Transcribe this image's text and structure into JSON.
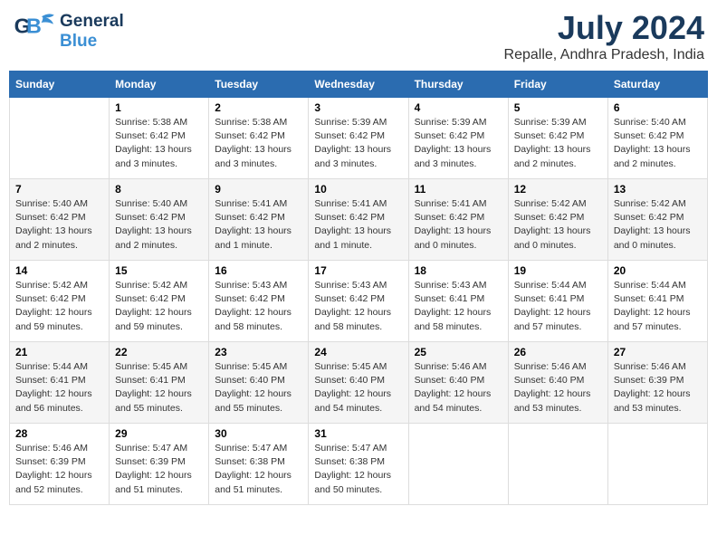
{
  "header": {
    "title": "July 2024",
    "subtitle": "Repalle, Andhra Pradesh, India",
    "logo_general": "General",
    "logo_blue": "Blue"
  },
  "columns": [
    "Sunday",
    "Monday",
    "Tuesday",
    "Wednesday",
    "Thursday",
    "Friday",
    "Saturday"
  ],
  "weeks": [
    {
      "cells": [
        {
          "day": "",
          "info": ""
        },
        {
          "day": "1",
          "info": "Sunrise: 5:38 AM\nSunset: 6:42 PM\nDaylight: 13 hours\nand 3 minutes."
        },
        {
          "day": "2",
          "info": "Sunrise: 5:38 AM\nSunset: 6:42 PM\nDaylight: 13 hours\nand 3 minutes."
        },
        {
          "day": "3",
          "info": "Sunrise: 5:39 AM\nSunset: 6:42 PM\nDaylight: 13 hours\nand 3 minutes."
        },
        {
          "day": "4",
          "info": "Sunrise: 5:39 AM\nSunset: 6:42 PM\nDaylight: 13 hours\nand 3 minutes."
        },
        {
          "day": "5",
          "info": "Sunrise: 5:39 AM\nSunset: 6:42 PM\nDaylight: 13 hours\nand 2 minutes."
        },
        {
          "day": "6",
          "info": "Sunrise: 5:40 AM\nSunset: 6:42 PM\nDaylight: 13 hours\nand 2 minutes."
        }
      ]
    },
    {
      "cells": [
        {
          "day": "7",
          "info": "Sunrise: 5:40 AM\nSunset: 6:42 PM\nDaylight: 13 hours\nand 2 minutes."
        },
        {
          "day": "8",
          "info": "Sunrise: 5:40 AM\nSunset: 6:42 PM\nDaylight: 13 hours\nand 2 minutes."
        },
        {
          "day": "9",
          "info": "Sunrise: 5:41 AM\nSunset: 6:42 PM\nDaylight: 13 hours\nand 1 minute."
        },
        {
          "day": "10",
          "info": "Sunrise: 5:41 AM\nSunset: 6:42 PM\nDaylight: 13 hours\nand 1 minute."
        },
        {
          "day": "11",
          "info": "Sunrise: 5:41 AM\nSunset: 6:42 PM\nDaylight: 13 hours\nand 0 minutes."
        },
        {
          "day": "12",
          "info": "Sunrise: 5:42 AM\nSunset: 6:42 PM\nDaylight: 13 hours\nand 0 minutes."
        },
        {
          "day": "13",
          "info": "Sunrise: 5:42 AM\nSunset: 6:42 PM\nDaylight: 13 hours\nand 0 minutes."
        }
      ]
    },
    {
      "cells": [
        {
          "day": "14",
          "info": "Sunrise: 5:42 AM\nSunset: 6:42 PM\nDaylight: 12 hours\nand 59 minutes."
        },
        {
          "day": "15",
          "info": "Sunrise: 5:42 AM\nSunset: 6:42 PM\nDaylight: 12 hours\nand 59 minutes."
        },
        {
          "day": "16",
          "info": "Sunrise: 5:43 AM\nSunset: 6:42 PM\nDaylight: 12 hours\nand 58 minutes."
        },
        {
          "day": "17",
          "info": "Sunrise: 5:43 AM\nSunset: 6:42 PM\nDaylight: 12 hours\nand 58 minutes."
        },
        {
          "day": "18",
          "info": "Sunrise: 5:43 AM\nSunset: 6:41 PM\nDaylight: 12 hours\nand 58 minutes."
        },
        {
          "day": "19",
          "info": "Sunrise: 5:44 AM\nSunset: 6:41 PM\nDaylight: 12 hours\nand 57 minutes."
        },
        {
          "day": "20",
          "info": "Sunrise: 5:44 AM\nSunset: 6:41 PM\nDaylight: 12 hours\nand 57 minutes."
        }
      ]
    },
    {
      "cells": [
        {
          "day": "21",
          "info": "Sunrise: 5:44 AM\nSunset: 6:41 PM\nDaylight: 12 hours\nand 56 minutes."
        },
        {
          "day": "22",
          "info": "Sunrise: 5:45 AM\nSunset: 6:41 PM\nDaylight: 12 hours\nand 55 minutes."
        },
        {
          "day": "23",
          "info": "Sunrise: 5:45 AM\nSunset: 6:40 PM\nDaylight: 12 hours\nand 55 minutes."
        },
        {
          "day": "24",
          "info": "Sunrise: 5:45 AM\nSunset: 6:40 PM\nDaylight: 12 hours\nand 54 minutes."
        },
        {
          "day": "25",
          "info": "Sunrise: 5:46 AM\nSunset: 6:40 PM\nDaylight: 12 hours\nand 54 minutes."
        },
        {
          "day": "26",
          "info": "Sunrise: 5:46 AM\nSunset: 6:40 PM\nDaylight: 12 hours\nand 53 minutes."
        },
        {
          "day": "27",
          "info": "Sunrise: 5:46 AM\nSunset: 6:39 PM\nDaylight: 12 hours\nand 53 minutes."
        }
      ]
    },
    {
      "cells": [
        {
          "day": "28",
          "info": "Sunrise: 5:46 AM\nSunset: 6:39 PM\nDaylight: 12 hours\nand 52 minutes."
        },
        {
          "day": "29",
          "info": "Sunrise: 5:47 AM\nSunset: 6:39 PM\nDaylight: 12 hours\nand 51 minutes."
        },
        {
          "day": "30",
          "info": "Sunrise: 5:47 AM\nSunset: 6:38 PM\nDaylight: 12 hours\nand 51 minutes."
        },
        {
          "day": "31",
          "info": "Sunrise: 5:47 AM\nSunset: 6:38 PM\nDaylight: 12 hours\nand 50 minutes."
        },
        {
          "day": "",
          "info": ""
        },
        {
          "day": "",
          "info": ""
        },
        {
          "day": "",
          "info": ""
        }
      ]
    }
  ]
}
